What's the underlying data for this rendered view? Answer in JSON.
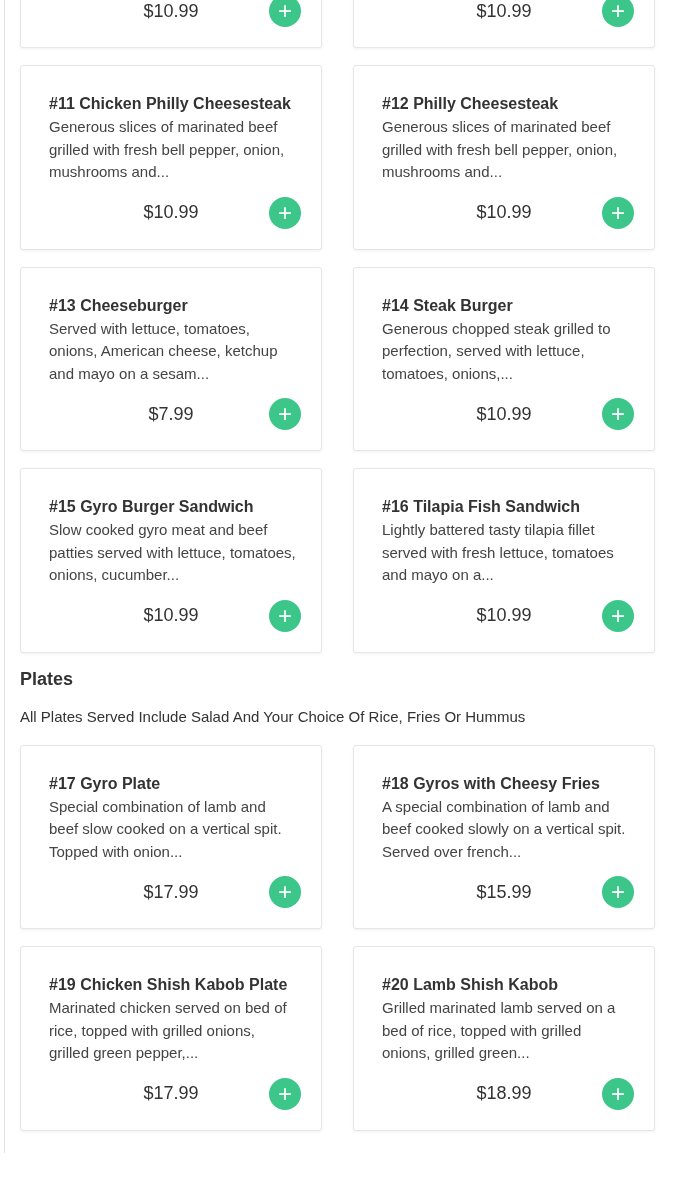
{
  "sections": [
    {
      "items": [
        {
          "price": "$10.99",
          "add_button": "+"
        },
        {
          "price": "$10.99",
          "add_button": "+"
        },
        {
          "name": "#11 Chicken Philly Cheesesteak",
          "description": "Generous slices of marinated beef grilled with fresh bell pepper, onion, mushrooms and...",
          "price": "$10.99",
          "add_button": "+"
        },
        {
          "name": "#12 Philly Cheesesteak",
          "description": "Generous slices of marinated beef grilled with fresh bell pepper, onion, mushrooms and...",
          "price": "$10.99",
          "add_button": "+"
        },
        {
          "name": "#13 Cheeseburger",
          "description": "Served with lettuce, tomatoes, onions, American cheese, ketchup and mayo on a sesam...",
          "price": "$7.99",
          "add_button": "+"
        },
        {
          "name": "#14 Steak Burger",
          "description": "Generous chopped steak grilled to perfection, served with lettuce, tomatoes, onions,...",
          "price": "$10.99",
          "add_button": "+"
        },
        {
          "name": "#15 Gyro Burger Sandwich",
          "description": "Slow cooked gyro meat and beef patties served with lettuce, tomatoes, onions, cucumber...",
          "price": "$10.99",
          "add_button": "+"
        },
        {
          "name": "#16 Tilapia Fish Sandwich",
          "description": "Lightly battered tasty tilapia fillet served with fresh lettuce, tomatoes and mayo on a...",
          "price": "$10.99",
          "add_button": "+"
        }
      ]
    },
    {
      "title": "Plates",
      "subtitle": "All Plates Served Include Salad And Your Choice Of Rice, Fries Or Hummus",
      "items": [
        {
          "name": "#17 Gyro Plate",
          "description": "Special combination of lamb and beef slow cooked on a vertical spit. Topped with onion...",
          "price": "$17.99",
          "add_button": "+"
        },
        {
          "name": "#18 Gyros with Cheesy Fries",
          "description": "A special combination of lamb and beef cooked slowly on a vertical spit. Served over french...",
          "price": "$15.99",
          "add_button": "+"
        },
        {
          "name": "#19 Chicken Shish Kabob Plate",
          "description": "Marinated chicken served on bed of rice, topped with grilled onions, grilled green pepper,...",
          "price": "$17.99",
          "add_button": "+"
        },
        {
          "name": "#20 Lamb Shish Kabob",
          "description": "Grilled marinated lamb served on a bed of rice, topped with grilled onions, grilled green...",
          "price": "$18.99",
          "add_button": "+"
        }
      ]
    }
  ]
}
